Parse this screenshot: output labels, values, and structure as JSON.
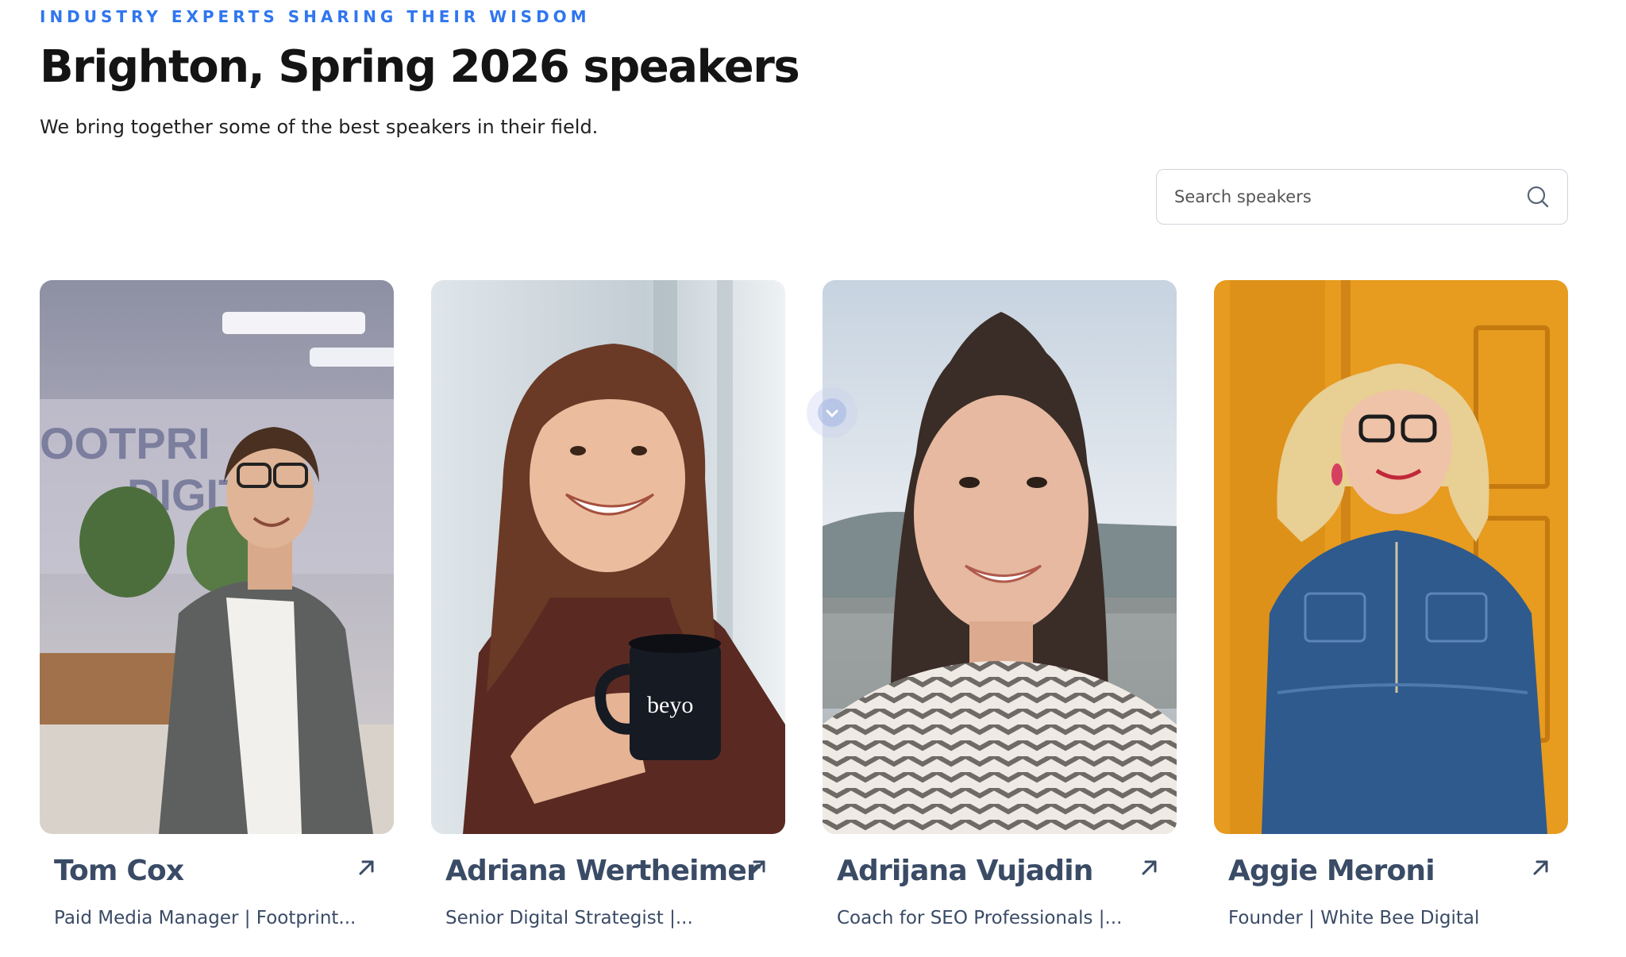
{
  "header": {
    "eyebrow": "INDUSTRY EXPERTS SHARING THEIR WISDOM",
    "title": "Brighton, Spring 2026 speakers",
    "subtitle": "We bring together some of the best speakers in their field."
  },
  "search": {
    "placeholder": "Search speakers",
    "value": "",
    "icon": "search-icon"
  },
  "speakers": [
    {
      "name": "Tom Cox",
      "role": "Paid Media Manager | Footprint...",
      "icon": "arrow-up-right-icon"
    },
    {
      "name": "Adriana Wertheimer",
      "role": "Senior Digital Strategist |...",
      "icon": "arrow-up-right-icon"
    },
    {
      "name": "Adrijana Vujadin",
      "role": "Coach for SEO Professionals |...",
      "icon": "arrow-up-right-icon"
    },
    {
      "name": "Aggie Meroni",
      "role": "Founder | White Bee Digital",
      "icon": "arrow-up-right-icon"
    }
  ],
  "colors": {
    "accent": "#2f76f0",
    "name_text": "#3a4b66",
    "heading_text": "#141414"
  }
}
